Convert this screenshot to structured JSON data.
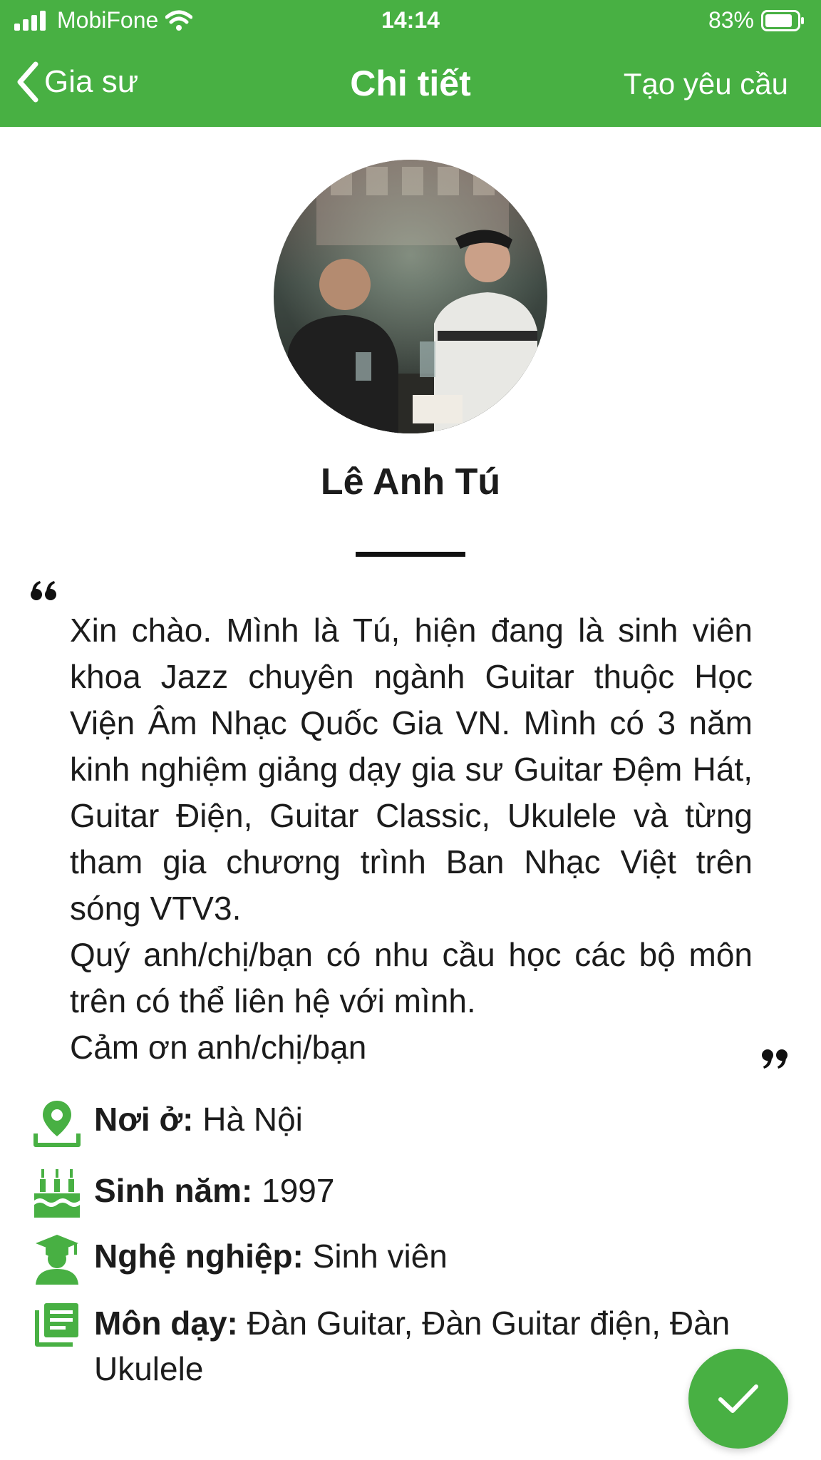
{
  "status_bar": {
    "carrier": "MobiFone",
    "time": "14:14",
    "battery": "83%"
  },
  "nav": {
    "back_label": "Gia sư",
    "title": "Chi tiết",
    "action_label": "Tạo yêu cầu"
  },
  "profile": {
    "name": "Lê Anh Tú",
    "bio_lines": [
      "Xin chào. Mình là Tú, hiện đang là sinh viên khoa Jazz chuyên ngành Guitar thuộc Học Viện Âm Nhạc Quốc Gia VN. Mình có 3 năm kinh nghiệm giảng dạy gia sư Guitar Đệm Hát, Guitar Điện, Guitar Classic, Ukulele và từng tham gia chương trình Ban Nhạc Việt trên sóng VTV3.",
      "Quý anh/chị/bạn có nhu cầu học các bộ môn trên có thể liên hệ với mình.",
      "Cảm ơn anh/chị/bạn"
    ],
    "info": {
      "residence_label": "Nơi ở:",
      "residence_value": "Hà Nội",
      "birth_year_label": "Sinh năm:",
      "birth_year_value": "1997",
      "occupation_label": "Nghệ nghiệp:",
      "occupation_value": "Sinh viên",
      "subjects_label": "Môn dạy:",
      "subjects_value": "Đàn Guitar, Đàn Guitar điện, Đàn Ukulele"
    }
  },
  "icons": {
    "back": "chevron-left-icon",
    "location": "location-pin-icon",
    "birthday": "birthday-cake-icon",
    "occupation": "graduate-icon",
    "subjects": "book-list-icon",
    "confirm": "checkmark-icon"
  },
  "colors": {
    "brand_green": "#48b043",
    "text": "#1c1c1c"
  }
}
